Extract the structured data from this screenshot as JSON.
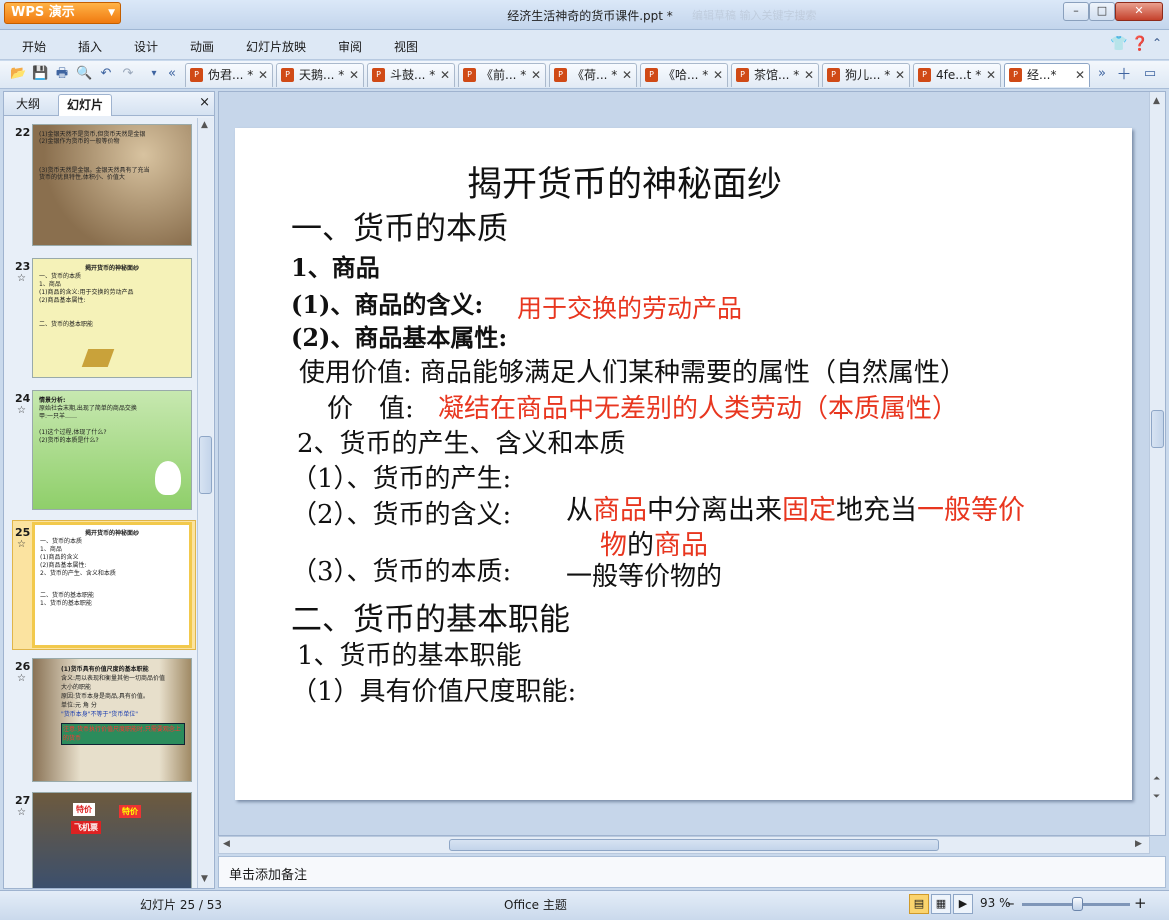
{
  "app": {
    "name": "WPS 演示",
    "doc_title": "经济生活神奇的货币课件.ppt *",
    "blurred_hint": "编辑草稿   输入关键字搜索"
  },
  "window": {
    "minimize": "–",
    "maximize": "□",
    "close": "✕"
  },
  "menu": {
    "items": [
      "开始",
      "插入",
      "设计",
      "动画",
      "幻灯片放映",
      "审阅",
      "视图"
    ],
    "right_icons": [
      "shirt-icon",
      "help-icon",
      "expand-icon"
    ]
  },
  "tabs": [
    {
      "label": "伪君... *",
      "active": false
    },
    {
      "label": "天鹅... *",
      "active": false
    },
    {
      "label": "斗鼓... *",
      "active": false
    },
    {
      "label": "《前... *",
      "active": false
    },
    {
      "label": "《荷... *",
      "active": false
    },
    {
      "label": "《哈... *",
      "active": false
    },
    {
      "label": "茶馆... *",
      "active": false
    },
    {
      "label": "狗儿... *",
      "active": false
    },
    {
      "label": "4fe...t *",
      "active": false
    },
    {
      "label": "经...*",
      "active": true
    }
  ],
  "panel": {
    "tabs": [
      "大纲",
      "幻灯片"
    ],
    "close": "×"
  },
  "thumbnails": [
    {
      "num": "22",
      "star": "",
      "lines": [
        "(1)金银天然不是货币,但货币天然是金银",
        "(2)金银作为货币的一般等价物",
        "(3)货币天然是金银。金银天然具有了充当",
        "货币的优良特性,体积小、价值大"
      ]
    },
    {
      "num": "23",
      "star": "☆",
      "lines": [
        "揭开货币的神秘面纱",
        "一、货币的本质",
        "1、商品",
        "(1)商品的含义:用于交换的劳动产品",
        "(2)商品基本属性:",
        "二、货币的基本职能"
      ]
    },
    {
      "num": "24",
      "star": "☆",
      "lines": [
        "情景分析:",
        "原始社会末期,出现了简单的商品交换",
        "甲:一只羊……",
        "(1)这个过程,体现了什么?",
        "(2)货币的本质是什么?"
      ]
    },
    {
      "num": "25",
      "star": "☆",
      "lines": [
        "揭开货币的神秘面纱",
        "一、货币的本质",
        "1、商品",
        "(1)商品的含义",
        "(2)商品基本属性:",
        "2、货币的产生、含义和本质",
        "二、货币的基本职能",
        "1、货币的基本职能"
      ]
    },
    {
      "num": "26",
      "star": "☆",
      "lines": [
        "(1)货币具有价值尺度的基本职能",
        "含义:用以表现和衡量其他一切商品价值",
        "大小的职能",
        "原因:货币本身是商品,具有价值。",
        "单位:元 角 分",
        "\"货币本身\"不等于\"货币单位\"",
        "注意:货币执行价值尺度职能时,只需要观念上的货币"
      ]
    },
    {
      "num": "27",
      "star": "☆",
      "lines": [
        "特价",
        "飞机票",
        "特价"
      ]
    }
  ],
  "slide": {
    "title": "揭开货币的神秘面纱",
    "s1": "一、货币的本质",
    "s1_1": "1、商品",
    "s1_1_1_label": "(1)、商品的含义:",
    "s1_1_1_value": "用于交换的劳动产品",
    "s1_1_2": "(2)、商品基本属性:",
    "use_value": "使用价值: 商品能够满足人们某种需要的属性（自然属性）",
    "value_label": "价　值:",
    "value_text": "凝结在商品中无差别的人类劳动（本质属性）",
    "s1_2": "2、货币的产生、含义和本质",
    "s1_2_1": "（1）、货币的产生:",
    "s1_2_2": "（2）、货币的含义:",
    "def_1": "从",
    "def_2": "商品",
    "def_3": "中分离出来",
    "def_4": "固定",
    "def_5": "地充当",
    "def_6": "一般等价",
    "def_7": "物",
    "def_8": "的",
    "def_9": "商品",
    "s1_2_3": "（3）、货币的本质:",
    "essence": "一般等价物的",
    "s2": "二、货币的基本职能",
    "s2_1": "1、货币的基本职能",
    "s2_1_1": "（1）具有价值尺度职能:"
  },
  "notes": {
    "placeholder": "单击添加备注"
  },
  "status": {
    "slide_info": "幻灯片 25 / 53",
    "theme": "Office 主题",
    "zoom": "93 %",
    "zoom_value": 93,
    "minus": "–",
    "plus": "+"
  },
  "colors": {
    "accent_red": "#e8361f",
    "app_orange": "#f07a10",
    "chrome_blue": "#c9d9ec"
  }
}
